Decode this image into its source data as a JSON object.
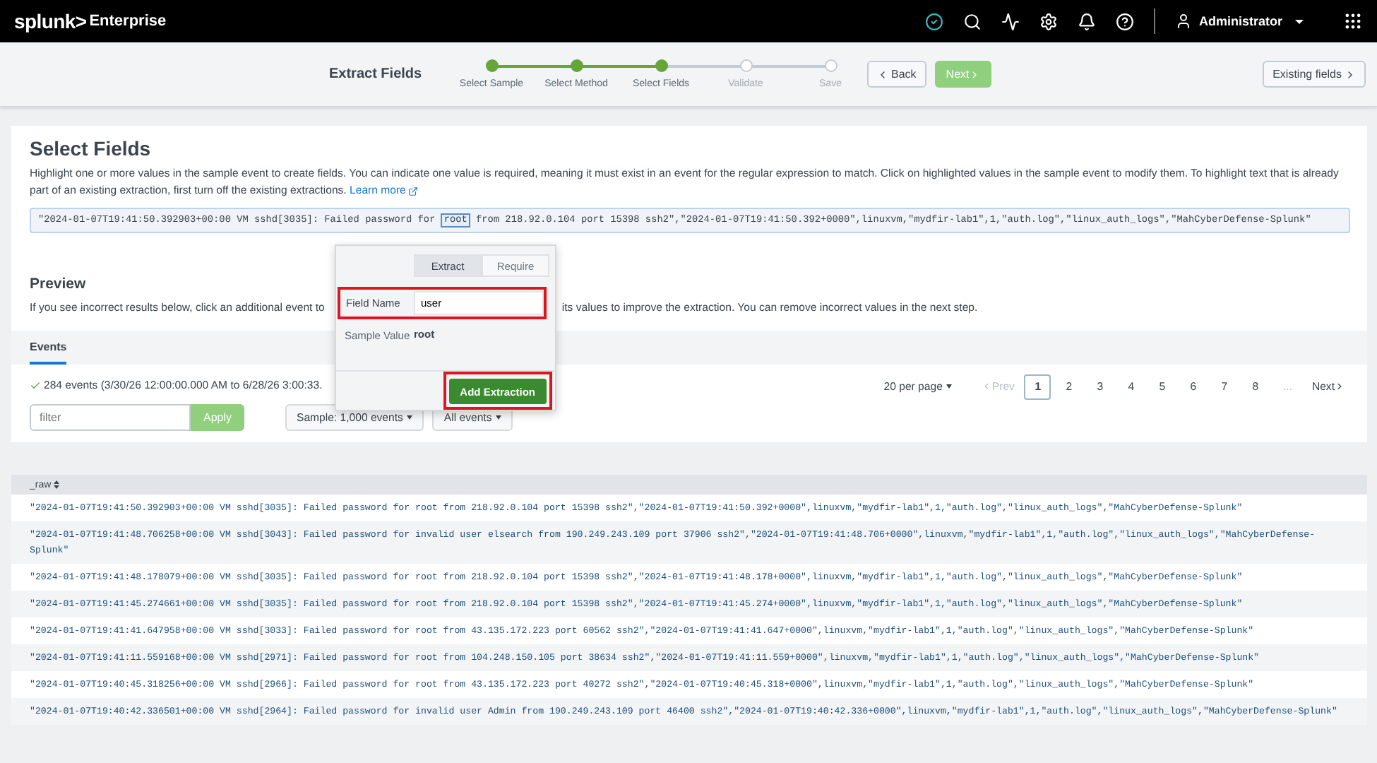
{
  "nav": {
    "brand": "splunk>",
    "product": "Enterprise",
    "user": "Administrator"
  },
  "wizard": {
    "title": "Extract Fields",
    "steps": [
      {
        "label": "Select Sample",
        "done": true
      },
      {
        "label": "Select Method",
        "done": true
      },
      {
        "label": "Select Fields",
        "done": true
      },
      {
        "label": "Validate",
        "done": false
      },
      {
        "label": "Save",
        "done": false
      }
    ],
    "back": "Back",
    "next": {
      "label": "Next",
      "disabled": true
    },
    "existing": "Existing fields"
  },
  "select_fields": {
    "title": "Select Fields",
    "description": "Highlight one or more values in the sample event to create fields. You can indicate one value is required, meaning it must exist in an event for the regular expression to match. Click on highlighted values in the sample event to modify them. To highlight text that is already part of an existing extraction, first turn off the existing extractions.",
    "link": "Learn more",
    "sample_event": {
      "before": "\"2024-01-07T19:41:50.392903+00:00 VM sshd[3035]: Failed password for ",
      "highlight": "root",
      "after": " from 218.92.0.104 port 15398 ssh2\",\"2024-01-07T19:41:50.392+0000\",linuxvm,\"mydfir-lab1\",1,\"auth.log\",\"linux_auth_logs\",\"MahCyberDefense-Splunk\""
    }
  },
  "popup": {
    "tabs": [
      {
        "label": "Extract",
        "selected": true
      },
      {
        "label": "Require",
        "selected": false
      }
    ],
    "field_label": "Field Name",
    "field_value": "user",
    "sample_label": "Sample Value",
    "sample_value": "root",
    "button": "Add Extraction"
  },
  "preview": {
    "title": "Preview",
    "description_start": "If you see incorrect results below, click an additional event to",
    "description_end": "its values to improve the extraction. You can remove incorrect values in the next step.",
    "tabs": [
      {
        "label": "Events",
        "selected": true
      }
    ],
    "count": "284 events (3/30/26 12:00:00.000 AM to 6/28/26 3:00:33.",
    "filter_placeholder": "filter",
    "apply": "Apply",
    "sample_dropdown": "Sample: 1,000 events",
    "events_dropdown": "All events",
    "per_page": "20 per page",
    "prev": {
      "label": "Prev",
      "disabled": true
    },
    "pages": [
      {
        "label": "1",
        "selected": true
      },
      {
        "label": "2",
        "selected": false
      },
      {
        "label": "3",
        "selected": false
      },
      {
        "label": "4",
        "selected": false
      },
      {
        "label": "5",
        "selected": false
      },
      {
        "label": "6",
        "selected": false
      },
      {
        "label": "7",
        "selected": false
      },
      {
        "label": "8",
        "selected": false
      }
    ],
    "ellipsis": "...",
    "next": "Next"
  },
  "table": {
    "column": "_raw",
    "rows": [
      "\"2024-01-07T19:41:50.392903+00:00 VM sshd[3035]: Failed password for root from 218.92.0.104 port 15398 ssh2\",\"2024-01-07T19:41:50.392+0000\",linuxvm,\"mydfir-lab1\",1,\"auth.log\",\"linux_auth_logs\",\"MahCyberDefense-Splunk\"",
      "\"2024-01-07T19:41:48.706258+00:00 VM sshd[3043]: Failed password for invalid user elsearch from 190.249.243.109 port 37906 ssh2\",\"2024-01-07T19:41:48.706+0000\",linuxvm,\"mydfir-lab1\",1,\"auth.log\",\"linux_auth_logs\",\"MahCyberDefense-Splunk\"",
      "\"2024-01-07T19:41:48.178079+00:00 VM sshd[3035]: Failed password for root from 218.92.0.104 port 15398 ssh2\",\"2024-01-07T19:41:48.178+0000\",linuxvm,\"mydfir-lab1\",1,\"auth.log\",\"linux_auth_logs\",\"MahCyberDefense-Splunk\"",
      "\"2024-01-07T19:41:45.274661+00:00 VM sshd[3035]: Failed password for root from 218.92.0.104 port 15398 ssh2\",\"2024-01-07T19:41:45.274+0000\",linuxvm,\"mydfir-lab1\",1,\"auth.log\",\"linux_auth_logs\",\"MahCyberDefense-Splunk\"",
      "\"2024-01-07T19:41:41.647958+00:00 VM sshd[3033]: Failed password for root from 43.135.172.223 port 60562 ssh2\",\"2024-01-07T19:41:41.647+0000\",linuxvm,\"mydfir-lab1\",1,\"auth.log\",\"linux_auth_logs\",\"MahCyberDefense-Splunk\"",
      "\"2024-01-07T19:41:11.559168+00:00 VM sshd[2971]: Failed password for root from 104.248.150.105 port 38634 ssh2\",\"2024-01-07T19:41:11.559+0000\",linuxvm,\"mydfir-lab1\",1,\"auth.log\",\"linux_auth_logs\",\"MahCyberDefense-Splunk\"",
      "\"2024-01-07T19:40:45.318256+00:00 VM sshd[2966]: Failed password for root from 43.135.172.223 port 40272 ssh2\",\"2024-01-07T19:40:45.318+0000\",linuxvm,\"mydfir-lab1\",1,\"auth.log\",\"linux_auth_logs\",\"MahCyberDefense-Splunk\"",
      "\"2024-01-07T19:40:42.336501+00:00 VM sshd[2964]: Failed password for invalid user Admin from 190.249.243.109 port 46400 ssh2\",\"2024-01-07T19:40:42.336+0000\",linuxvm,\"mydfir-lab1\",1,\"auth.log\",\"linux_auth_logs\",\"MahCyberDefense-Splunk\""
    ]
  }
}
